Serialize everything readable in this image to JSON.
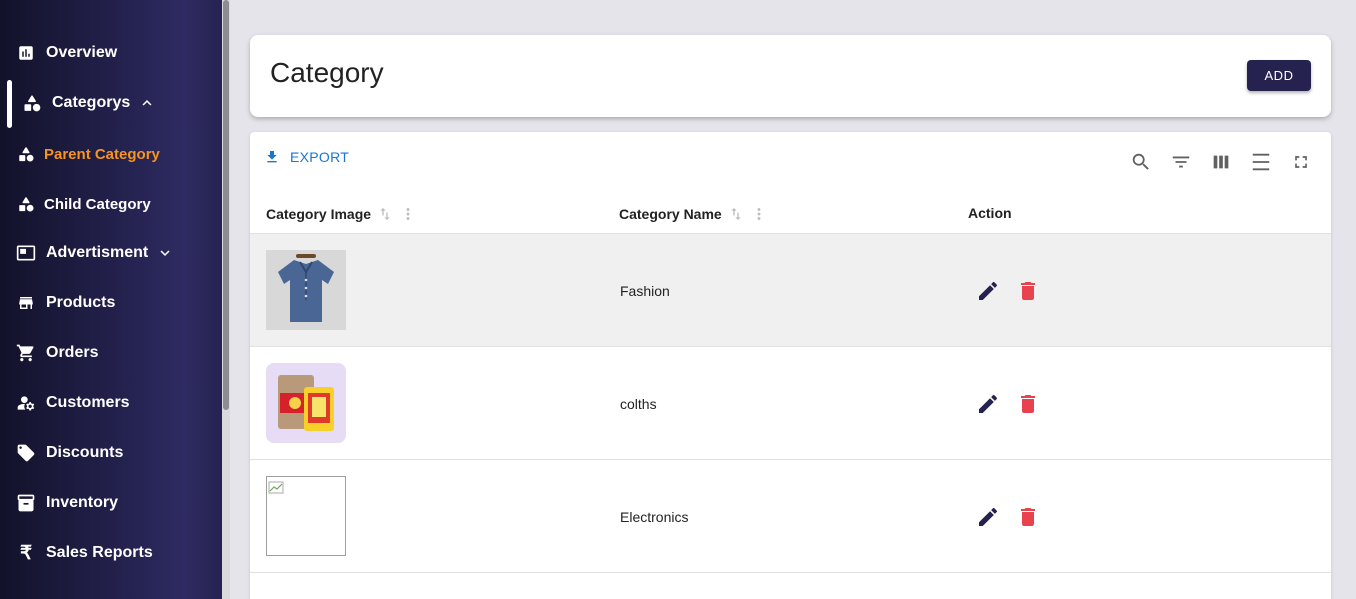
{
  "sidebar": {
    "items": [
      {
        "label": "Overview",
        "icon": "chart-icon"
      },
      {
        "label": "Categorys",
        "icon": "shapes-icon"
      },
      {
        "label": "Parent Category",
        "icon": "shapes-icon"
      },
      {
        "label": "Child Category",
        "icon": "shapes-icon"
      },
      {
        "label": "Advertisment",
        "icon": "billboard-icon"
      },
      {
        "label": "Products",
        "icon": "store-icon"
      },
      {
        "label": "Orders",
        "icon": "cart-icon"
      },
      {
        "label": "Customers",
        "icon": "user-gear-icon"
      },
      {
        "label": "Discounts",
        "icon": "tag-icon"
      },
      {
        "label": "Inventory",
        "icon": "archive-icon"
      },
      {
        "label": "Sales Reports",
        "icon": "rupee-icon"
      }
    ],
    "active_color": "#f7941d"
  },
  "header": {
    "title": "Category",
    "add_label": "ADD"
  },
  "toolbar": {
    "export_label": "EXPORT"
  },
  "table": {
    "columns": [
      "Category Image",
      "Category Name",
      "Action"
    ],
    "rows": [
      {
        "name": "Fashion",
        "image": "shirt"
      },
      {
        "name": "colths",
        "image": "grocery-pack"
      },
      {
        "name": "Electronics",
        "image": "broken-image"
      }
    ]
  },
  "colors": {
    "primary": "#252250",
    "delete": "#e9424f",
    "link": "#1976d2"
  }
}
